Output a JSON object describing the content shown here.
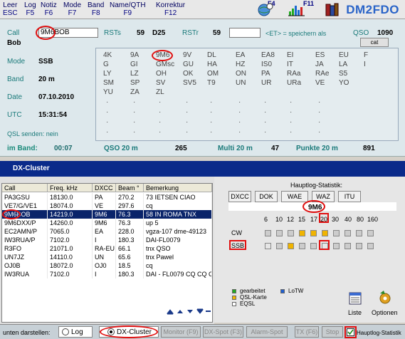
{
  "menu": [
    {
      "label": "Leer",
      "key": "ESC"
    },
    {
      "label": "Log",
      "key": "F5"
    },
    {
      "label": "Notiz",
      "key": "F6"
    },
    {
      "label": "Mode",
      "key": "F7"
    },
    {
      "label": "Band",
      "key": "F8"
    },
    {
      "label": "Name/QTH",
      "key": "F9"
    },
    {
      "label": "Korrektur",
      "key": "F12"
    }
  ],
  "toolbar": {
    "f4": "F4",
    "f11": "F11",
    "callsign": "DM2FDO"
  },
  "qso": {
    "call_label": "Call",
    "call_value": "9M6BOB",
    "name_value": "Bob",
    "rsts_label": "RSTs",
    "rsts_value": "59",
    "rsts_extra": "D25",
    "rstr_label": "RSTr",
    "rstr_value": "59",
    "et_hint": "<ET> = speichern als",
    "qso_label": "QSO",
    "qso_value": "1090",
    "cat_label": "cat",
    "mode_label": "Mode",
    "mode_value": "SSB",
    "band_label": "Band",
    "band_value": "20 m",
    "date_label": "Date",
    "date_value": "07.10.2010",
    "utc_label": "UTC",
    "utc_value": "15:31:54",
    "qsl_label": "QSL senden: nein",
    "imband_label": "im Band:",
    "imband_value": "00:07",
    "qso20_label": "QSO 20 m",
    "qso20_value": "265",
    "multi_label": "Multi 20 m",
    "multi_value": "47",
    "punkte_label": "Punkte 20 m",
    "punkte_value": "891"
  },
  "prefixes": [
    [
      "4K",
      "9A",
      "9M6",
      "9V",
      "DL",
      "EA",
      "EA8",
      "EI",
      "ES",
      "EU",
      "F"
    ],
    [
      "G",
      "GI",
      "GMsc",
      "GU",
      "HA",
      "HZ",
      "IS0",
      "IT",
      "JA",
      "LA",
      "I"
    ],
    [
      "LY",
      "LZ",
      "OH",
      "OK",
      "OM",
      "ON",
      "PA",
      "RAa",
      "RAe",
      "S5"
    ],
    [
      "SM",
      "SP",
      "SV",
      "SV5",
      "T9",
      "UN",
      "UR",
      "URa",
      "VE",
      "YO"
    ],
    [
      "YU",
      "ZA",
      "ZL"
    ]
  ],
  "dx_cluster": {
    "title": "DX-Cluster",
    "columns": [
      "Call",
      "Freq. kHz",
      "DXCC",
      "Beam °",
      "Bemerkung"
    ],
    "rows": [
      [
        "PA3GSU",
        "18130.0",
        "PA",
        "270.2",
        "73 IETSEN CIAO"
      ],
      [
        "VE7/G/VE1",
        "18074.0",
        "VE",
        "297.6",
        "cq"
      ],
      [
        "9M6BOB",
        "14219.0",
        "9M6",
        "76.3",
        "58 IN ROMA TNX"
      ],
      [
        "9M6DXX/P",
        "14260.0",
        "9M6",
        "76.3",
        "up 5"
      ],
      [
        "EC2AMN/P",
        "7065.0",
        "EA",
        "228.0",
        "vgza-107 dme-49123"
      ],
      [
        "IW3RUA/P",
        "7102.0",
        "I",
        "180.3",
        "DAI-FL0079"
      ],
      [
        "R3FO",
        "21071.0",
        "RA-EU",
        "66.1",
        "tnx QSO"
      ],
      [
        "UN7JZ",
        "14110.0",
        "UN",
        "65.6",
        "tnx Pawel"
      ],
      [
        "OJ0B",
        "18072.0",
        "OJ0",
        "18.5",
        "cq"
      ],
      [
        "IW3RUA",
        "7102.0",
        "I",
        "180.3",
        "DAI - FL0079 CQ CQ C"
      ]
    ]
  },
  "stats": {
    "title": "Hauptlog-Statistik:",
    "tabs": [
      "DXCC",
      "DOK",
      "WAE",
      "WAZ",
      "ITU"
    ],
    "prefix": "9M6",
    "bands": [
      "6",
      "10",
      "12",
      "15",
      "17",
      "20",
      "30",
      "40",
      "80",
      "160"
    ],
    "rows": [
      {
        "label": "CW",
        "cells": [
          "gray",
          "gray",
          "gray",
          "orange",
          "orange",
          "orange",
          "gray",
          "gray",
          "gray",
          "gray"
        ]
      },
      {
        "label": "SSB",
        "cells": [
          "none",
          "gray",
          "orange",
          "gray",
          "gray",
          "none",
          "gray",
          "gray",
          "gray",
          "gray"
        ]
      }
    ],
    "legend": [
      {
        "label": "gearbeitet",
        "color": "#22aa22"
      },
      {
        "label": "QSL-Karte",
        "color": "#f0b400"
      },
      {
        "label": "EQSL",
        "color": "#ffffff"
      },
      {
        "label": "LoTW",
        "color": "#1f5fd0"
      }
    ],
    "liste_label": "Liste",
    "optionen_label": "Optionen"
  },
  "bottom": {
    "unten_label": "unten darstellen:",
    "log_label": "Log",
    "dxcluster_label": "DX-Cluster",
    "buttons": [
      "Monitor (F9)",
      "DX-Spot (F3)",
      "Alarm-Spot",
      "TX (F6)",
      "Stop"
    ],
    "stat_check_label": "Hauptlog-Statistik"
  }
}
